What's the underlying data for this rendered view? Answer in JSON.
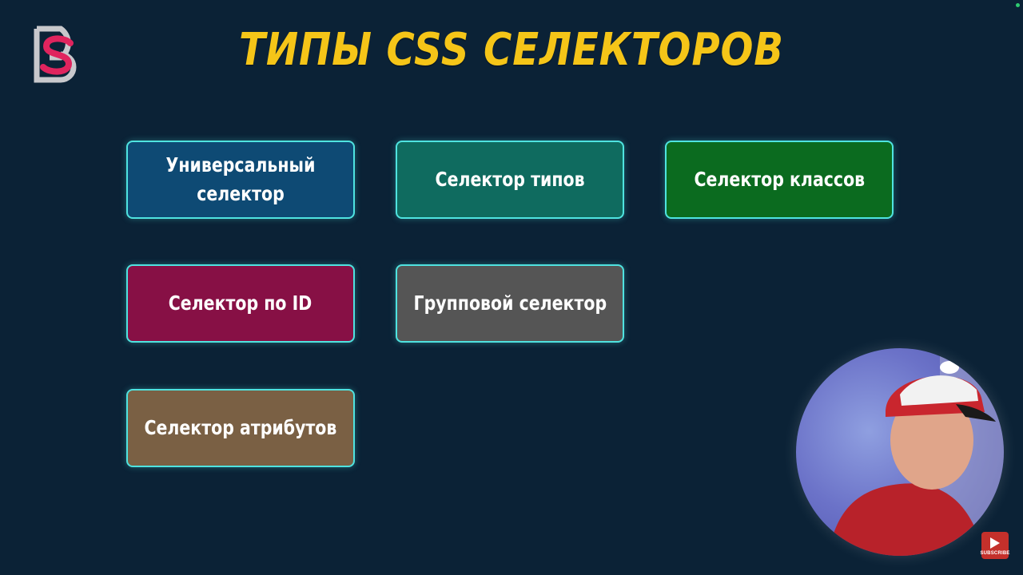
{
  "title": "ТИПЫ CSS СЕЛЕКТОРОВ",
  "cards": [
    {
      "label": "Универсальный селектор",
      "bg": "#0e4a74"
    },
    {
      "label": "Селектор типов",
      "bg": "#0f6b5f"
    },
    {
      "label": "Селектор классов",
      "bg": "#0b6b1f"
    },
    {
      "label": "Селектор по ID",
      "bg": "#871045"
    },
    {
      "label": "Групповой селектор",
      "bg": "#555555"
    },
    {
      "label": "Селектор атрибутов",
      "bg": "#7a6044"
    }
  ],
  "subscribe": {
    "label": "SUBSCRIBE",
    "icon": "play-icon"
  },
  "colors": {
    "background": "#0b2236",
    "title": "#f5c518",
    "card_border": "#4fe3e0",
    "logo_pink": "#e0245e",
    "logo_gray": "#c8c8cc"
  }
}
